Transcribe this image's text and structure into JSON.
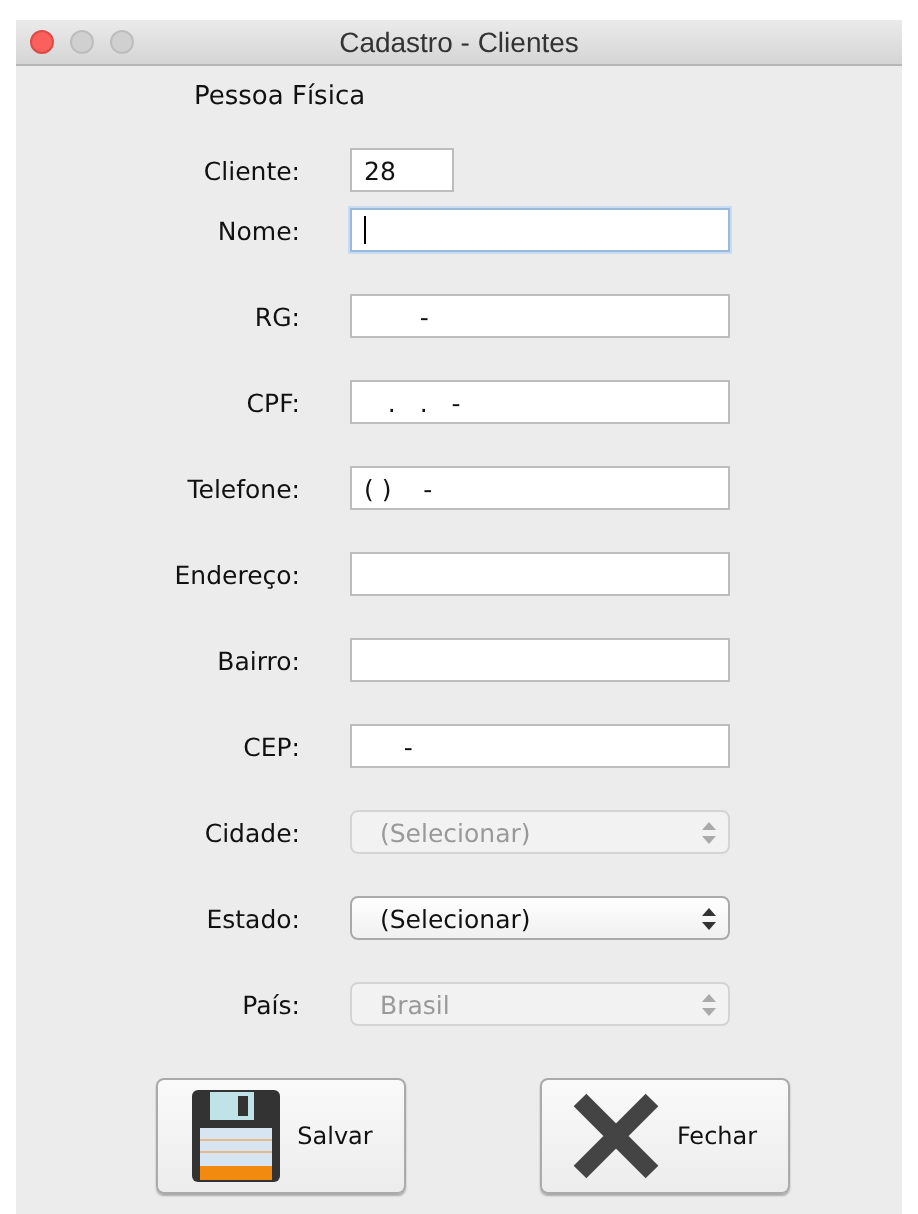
{
  "window": {
    "title": "Cadastro - Clientes"
  },
  "heading": "Pessoa Física",
  "fields": [
    {
      "label": "Cliente:",
      "kind": "short",
      "value": "28",
      "focused": false
    },
    {
      "label": "Nome:",
      "kind": "text",
      "focused": true
    },
    {
      "label": "RG:",
      "kind": "text",
      "value": "       -",
      "focused": false
    },
    {
      "label": "CPF:",
      "kind": "text",
      "value": "   .   .   -",
      "focused": false
    },
    {
      "label": "Telefone:",
      "kind": "text",
      "value": "( )    -",
      "focused": false
    },
    {
      "label": "Endereço:",
      "kind": "text",
      "focused": false
    },
    {
      "label": "Bairro:",
      "kind": "text",
      "focused": false
    },
    {
      "label": "CEP:",
      "kind": "text",
      "value": "     -",
      "focused": false
    },
    {
      "label": "Cidade:",
      "kind": "select",
      "value": "(Selecionar)",
      "disabled": true
    },
    {
      "label": "Estado:",
      "kind": "select",
      "value": "(Selecionar)",
      "disabled": false
    },
    {
      "label": "País:",
      "kind": "select",
      "value": "Brasil",
      "disabled": true
    }
  ],
  "buttons": [
    {
      "label": "Salvar",
      "kind": "save"
    },
    {
      "label": "Fechar",
      "kind": "close"
    }
  ]
}
